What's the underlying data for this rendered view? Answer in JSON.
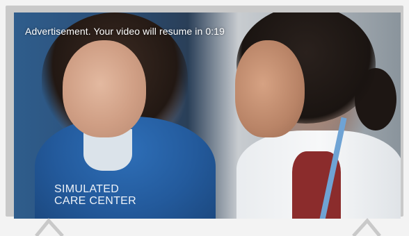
{
  "ad_overlay": {
    "message": "Advertisement. Your video will resume in 0:19"
  },
  "watermark": {
    "line1": "SIMULATED",
    "line2": "CARE CENTER"
  },
  "colors": {
    "tv_frame": "#c9c9c9",
    "page_background": "#f3f3f3",
    "overlay_text": "#ffffff"
  }
}
